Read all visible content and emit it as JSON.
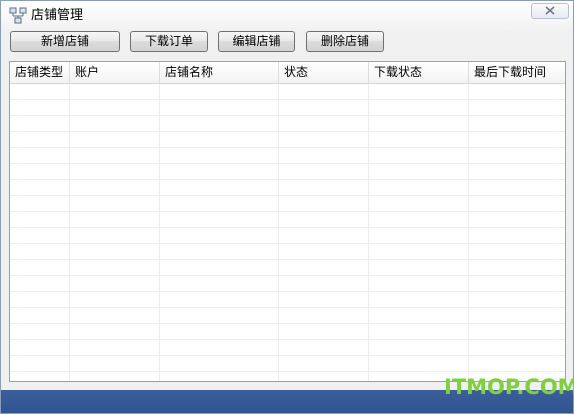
{
  "window": {
    "title": "店铺管理",
    "close_icon": "close-icon",
    "app_icon": "store-network-icon"
  },
  "toolbar": {
    "add_store": "新增店铺",
    "download_orders": "下载订单",
    "edit_store": "编辑店铺",
    "delete_store": "删除店铺"
  },
  "table": {
    "columns": [
      "店铺类型",
      "账户",
      "店铺名称",
      "状态",
      "下载状态",
      "最后下载时间"
    ],
    "rows": []
  },
  "watermark": "ITMOP.COM",
  "colors": {
    "statusbar": "#2f548f",
    "watermark": "#7fcf3f"
  }
}
